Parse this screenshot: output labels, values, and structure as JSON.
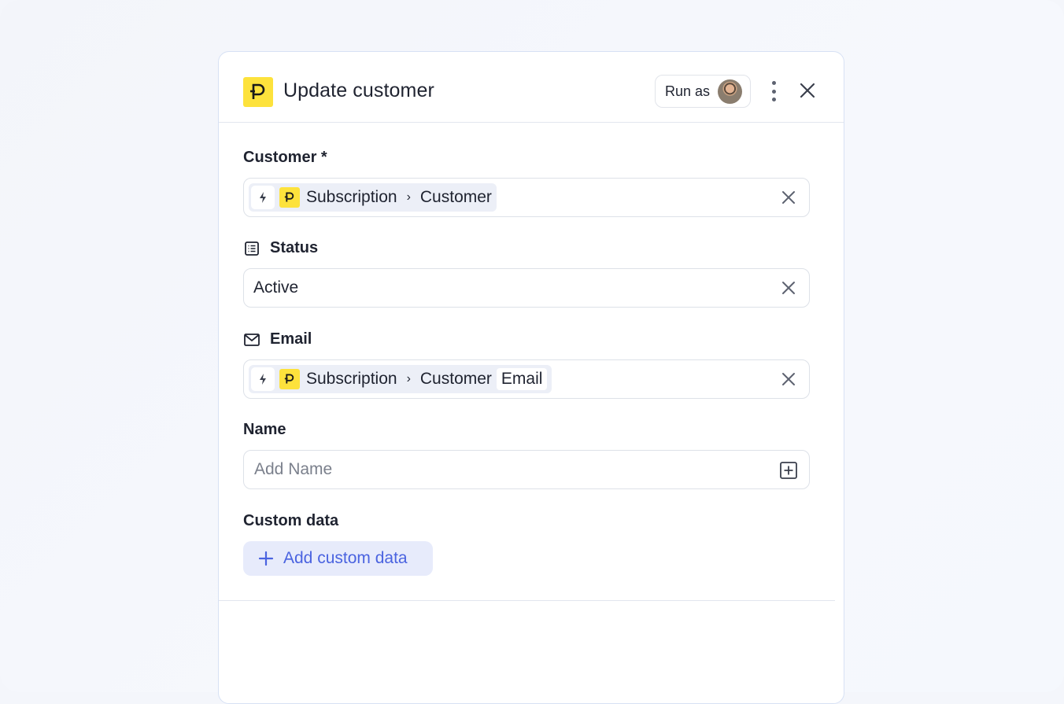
{
  "header": {
    "title": "Update customer",
    "run_as_label": "Run as",
    "app_icon": "app-logo-icon",
    "more_icon": "kebab-menu-icon",
    "close_icon": "close-icon"
  },
  "fields": {
    "customer": {
      "label": "Customer *",
      "chip": {
        "source": "Subscription",
        "separator": "›",
        "target": "Customer"
      }
    },
    "status": {
      "label": "Status",
      "icon": "list-icon",
      "value": "Active"
    },
    "email": {
      "label": "Email",
      "icon": "mail-icon",
      "chip": {
        "source": "Subscription",
        "separator": "›",
        "target": "Customer",
        "sub": "Email"
      }
    },
    "name": {
      "label": "Name",
      "placeholder": "Add Name"
    },
    "custom_data": {
      "label": "Custom data",
      "button_label": "Add custom data"
    }
  },
  "colors": {
    "brand_yellow": "#fde23c",
    "accent_blue": "#4a63e0",
    "accent_blue_bg": "#e7ebfb",
    "text": "#1f2330",
    "border": "#dde1e8"
  }
}
